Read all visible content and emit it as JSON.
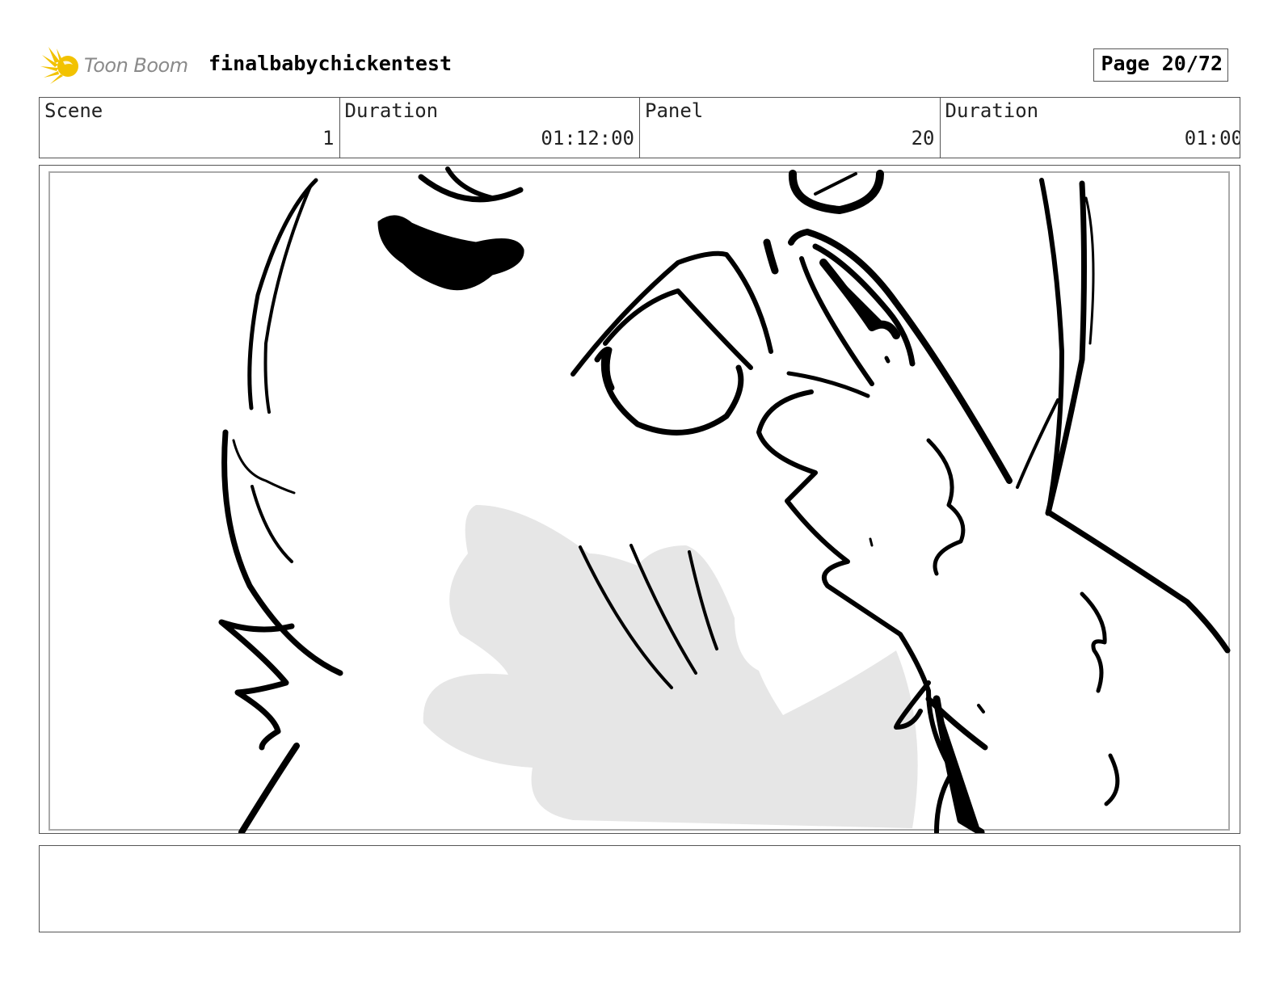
{
  "header": {
    "logo_text": "Toon Boom",
    "project_title": "finalbabychickentest",
    "page_label": "Page 20/72"
  },
  "info": {
    "scene_label": "Scene",
    "scene_value": "1",
    "scene_duration_label": "Duration",
    "scene_duration_value": "01:12:00",
    "panel_label": "Panel",
    "panel_value": "20",
    "panel_duration_label": "Duration",
    "panel_duration_value": "01:00"
  },
  "colors": {
    "logo_star": "#f2c200",
    "logo_text": "#8a8a8a",
    "sketch_line": "#000000",
    "sketch_shadow": "#e6e6e6"
  },
  "notes": {
    "text": ""
  }
}
